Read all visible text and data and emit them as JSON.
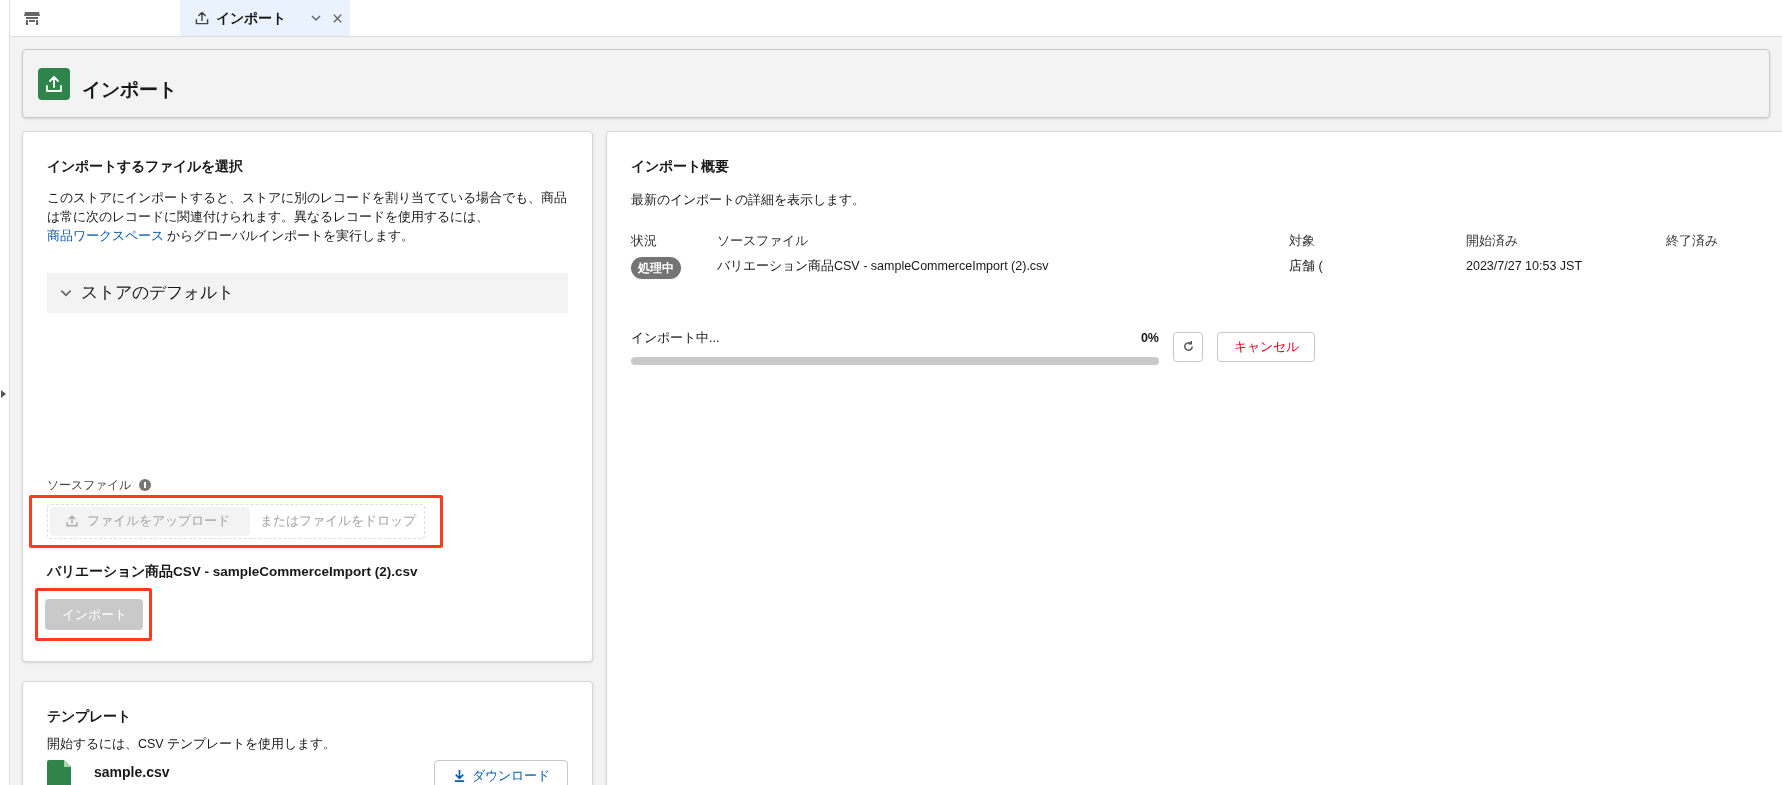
{
  "tabs": [
    {
      "kind": "home",
      "selected": false
    },
    {
      "kind": "page",
      "label": "インポート",
      "selected": true
    }
  ],
  "header": {
    "title": "インポート"
  },
  "select_file": {
    "title": "インポートするファイルを選択",
    "description": "このストアにインポートすると、ストアに別のレコードを割り当てている場合でも、商品は常に次のレコードに関連付けられます。異なるレコードを使用するには、",
    "link": "商品ワークスペース",
    "description_end": " からグローバルインポートを実行します。",
    "accordion": {
      "label": "ストアのデフォルト",
      "expanded": true
    },
    "source_label": "ソースファイル",
    "upload_button": {
      "label": "ファイルをアップロード",
      "disabled": true
    },
    "drop_hint": "またはファイルをドロップ",
    "file_name": "バリエーション商品CSV - sampleCommerceImport (2).csv",
    "import_button": {
      "label": "インポート",
      "disabled": true
    }
  },
  "template": {
    "title": "テンプレート",
    "description": "開始するには、CSV テンプレートを使用します。",
    "file": "sample.csv",
    "download_button": "ダウンロード"
  },
  "summary": {
    "title": "インポート概要",
    "description": "最新のインポートの詳細を表示します。",
    "columns": [
      "状況",
      "ソースファイル",
      "対象",
      "開始済み",
      "終了済み"
    ],
    "row": {
      "status": "処理中",
      "source": "バリエーション商品CSV - sampleCommerceImport (2).csv",
      "target": "店舗 (",
      "started": "2023/7/27 10:53 JST"
    },
    "progress": {
      "label": "インポート中...",
      "reading": "0%",
      "level": 0
    },
    "cancel_button": "キャンセル"
  }
}
